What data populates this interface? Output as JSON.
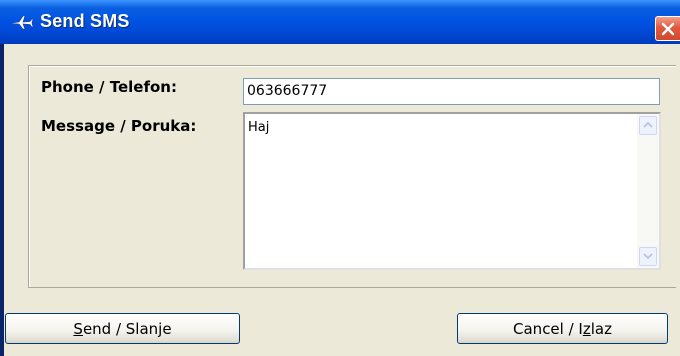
{
  "window": {
    "title": "Send SMS",
    "icon": "airplane-icon",
    "close_icon": "close-icon"
  },
  "form": {
    "phone_label": "Phone / Telefon:",
    "phone_value": "063666777",
    "message_label": "Message / Poruka:",
    "message_value": "Haj"
  },
  "buttons": {
    "send": {
      "mnemonic": "S",
      "rest": "end / Slanje"
    },
    "cancel": {
      "prefix": "Cancel / I",
      "mnemonic": "z",
      "rest": "laz"
    }
  },
  "colors": {
    "titlebar": "#0054e3",
    "client": "#ece9d8",
    "close": "#e2593d",
    "input_border": "#7f9db9"
  }
}
